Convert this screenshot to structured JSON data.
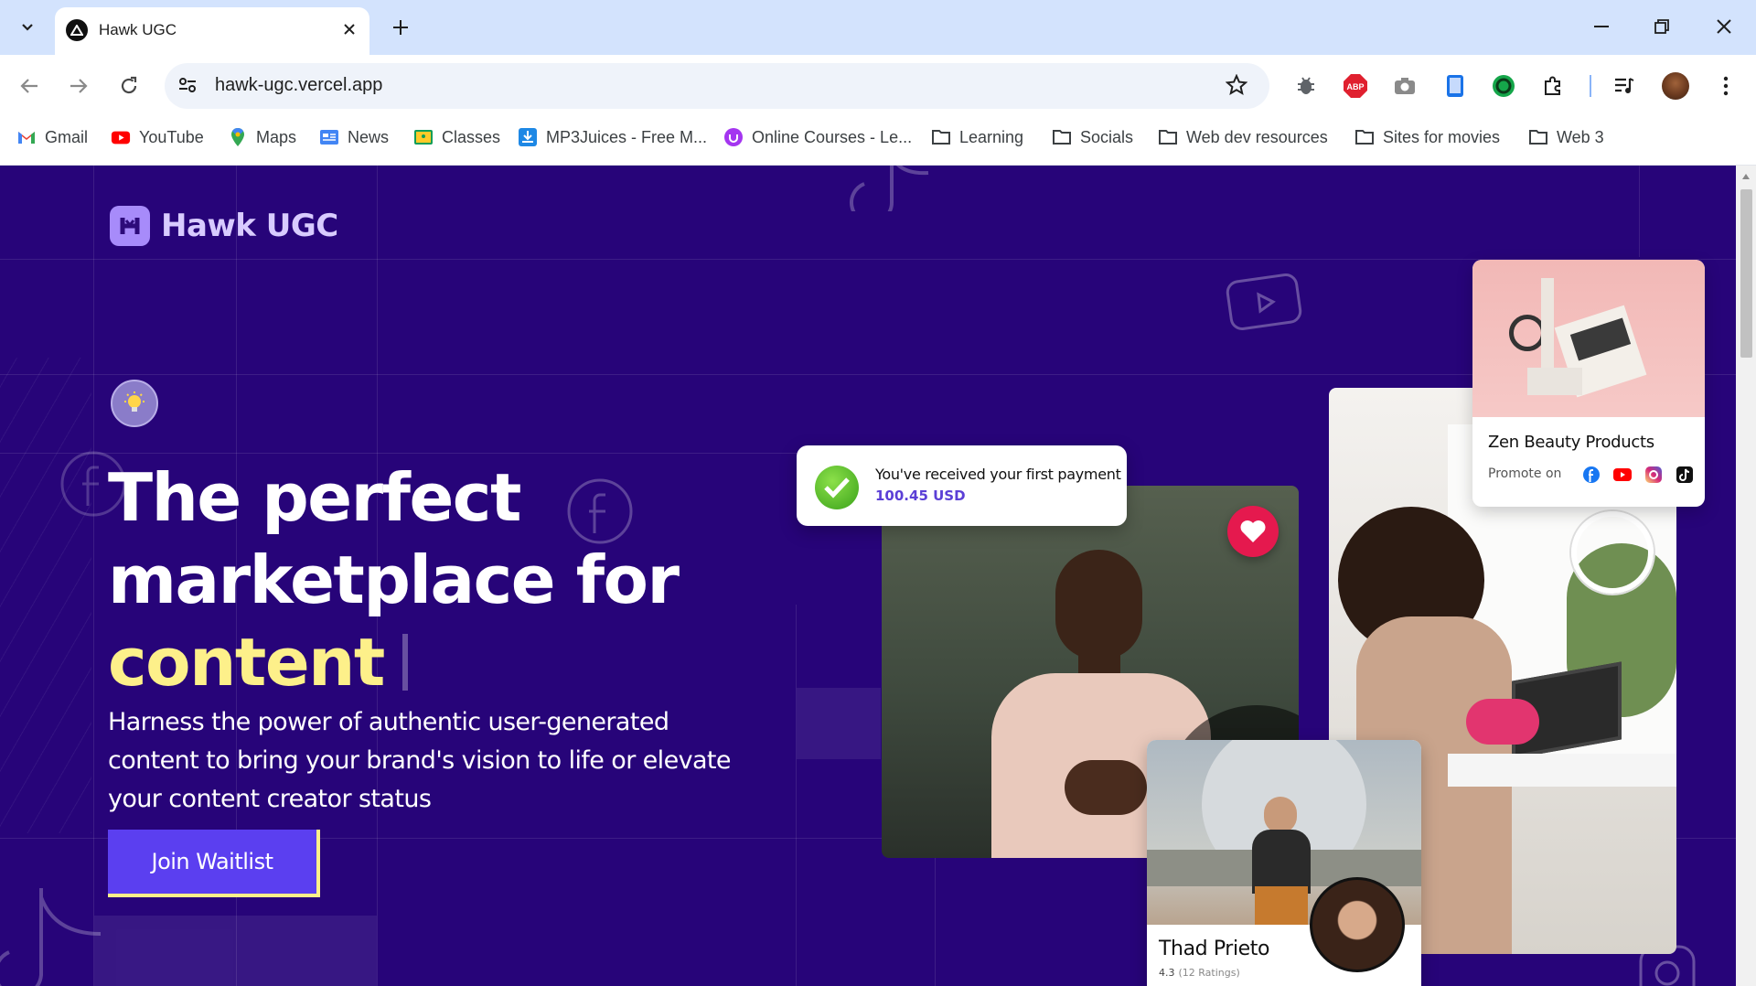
{
  "browser": {
    "tab_title": "Hawk UGC",
    "url": "hawk-ugc.vercel.app",
    "bookmarks": [
      {
        "label": "Gmail",
        "icon": "gmail-icon"
      },
      {
        "label": "YouTube",
        "icon": "youtube-icon"
      },
      {
        "label": "Maps",
        "icon": "maps-icon"
      },
      {
        "label": "News",
        "icon": "news-icon"
      },
      {
        "label": "Classes",
        "icon": "classes-icon"
      },
      {
        "label": "MP3Juices - Free M...",
        "icon": "download-icon"
      },
      {
        "label": "Online Courses - Le...",
        "icon": "udemy-icon"
      },
      {
        "label": "Learning",
        "icon": "folder-icon"
      },
      {
        "label": "Socials",
        "icon": "folder-icon"
      },
      {
        "label": "Web dev resources",
        "icon": "folder-icon"
      },
      {
        "label": "Sites for movies",
        "icon": "folder-icon"
      },
      {
        "label": "Web 3",
        "icon": "folder-icon"
      }
    ]
  },
  "site": {
    "brand": "Hawk UGC",
    "hero": {
      "title_line1": "The perfect",
      "title_line2": "marketplace for",
      "title_highlight": "content",
      "subtitle": "Harness the power of authentic user-generated content to bring your brand's vision to life or elevate your content creator status",
      "cta": "Join Waitlist"
    },
    "payment_toast": {
      "title": "You've received your first payment",
      "amount": "100.45 USD"
    },
    "product_card": {
      "name": "Zen Beauty Products",
      "promote_label": "Promote on"
    },
    "creator_card": {
      "name": "Thad Prieto",
      "rating": "4.3",
      "ratings_count": "(12 Ratings)"
    }
  },
  "colors": {
    "page_bg": "#270479",
    "accent_yellow": "#fdf08a",
    "button": "#5b3ff0",
    "amount": "#5b3fd6"
  }
}
